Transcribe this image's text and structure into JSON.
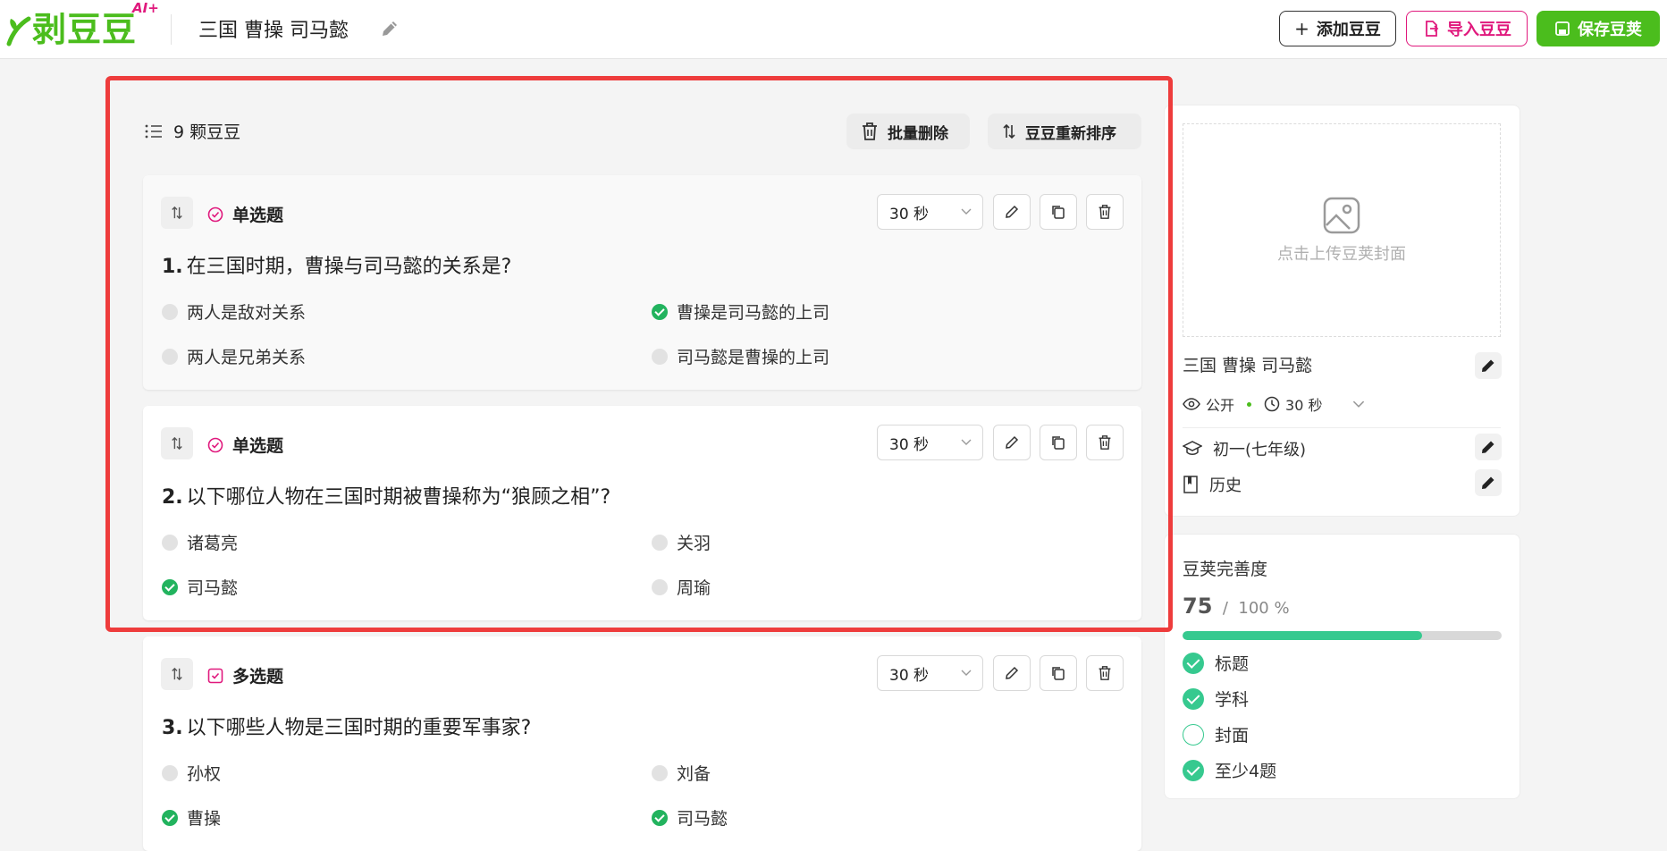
{
  "header": {
    "logo_text": "剥豆豆",
    "logo_badge": "AI+",
    "title": "三国 曹操 司马懿",
    "add_label": "添加豆豆",
    "import_label": "导入豆豆",
    "save_label": "保存豆荚"
  },
  "list": {
    "count_label": "9 颗豆豆",
    "batch_delete_label": "批量删除",
    "reorder_label": "豆豆重新排序"
  },
  "questions": [
    {
      "type": "单选题",
      "time": "30 秒",
      "number": "1.",
      "text": "在三国时期，曹操与司马懿的关系是?",
      "options": [
        {
          "text": "两人是敌对关系",
          "correct": false
        },
        {
          "text": "曹操是司马懿的上司",
          "correct": true
        },
        {
          "text": "两人是兄弟关系",
          "correct": false
        },
        {
          "text": "司马懿是曹操的上司",
          "correct": false
        }
      ]
    },
    {
      "type": "单选题",
      "time": "30 秒",
      "number": "2.",
      "text": "以下哪位人物在三国时期被曹操称为“狼顾之相”?",
      "options": [
        {
          "text": "诸葛亮",
          "correct": false
        },
        {
          "text": "关羽",
          "correct": false
        },
        {
          "text": "司马懿",
          "correct": true
        },
        {
          "text": "周瑜",
          "correct": false
        }
      ]
    },
    {
      "type": "多选题",
      "time": "30 秒",
      "number": "3.",
      "text": "以下哪些人物是三国时期的重要军事家?",
      "options": [
        {
          "text": "孙权",
          "correct": false
        },
        {
          "text": "刘备",
          "correct": false
        },
        {
          "text": "曹操",
          "correct": true
        },
        {
          "text": "司马懿",
          "correct": true
        }
      ]
    }
  ],
  "sidebar": {
    "cover_prompt": "点击上传豆荚封面",
    "title": "三国 曹操 司马懿",
    "visibility": "公开",
    "duration": "30 秒",
    "grade": "初一(七年级)",
    "subject": "历史",
    "completeness": {
      "title": "豆荚完善度",
      "score": "75",
      "separator": "/",
      "total": "100 %",
      "progress": 0.75,
      "items": [
        {
          "label": "标题",
          "done": true
        },
        {
          "label": "学科",
          "done": true
        },
        {
          "label": "封面",
          "done": false
        },
        {
          "label": "至少4题",
          "done": true
        }
      ]
    }
  },
  "colors": {
    "brand_green": "#4bbd1d",
    "accent_pink": "#e0197d",
    "correct_green": "#22b35e",
    "progress_green": "#36c98f",
    "highlight_red": "#ee3c3c"
  }
}
